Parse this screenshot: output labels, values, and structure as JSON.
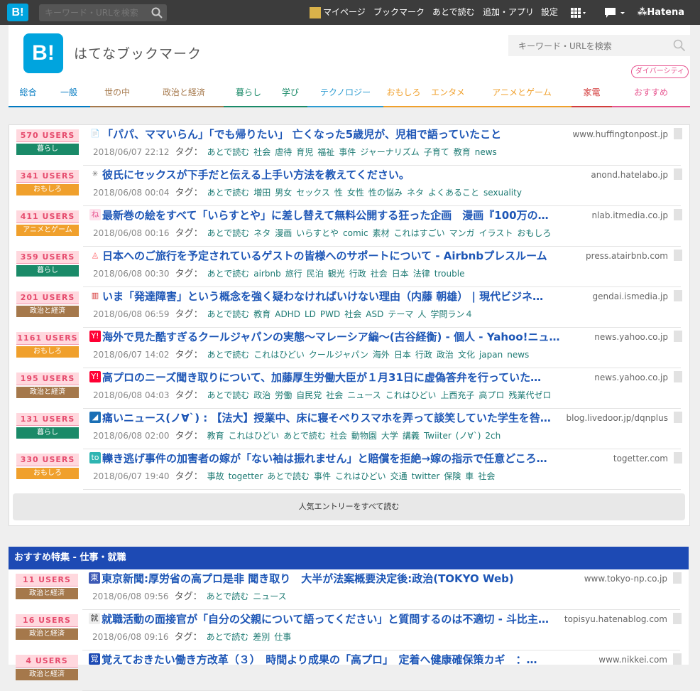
{
  "topbar": {
    "logo": "B!",
    "search_placeholder": "キーワード・URLを検索",
    "mypage": "マイページ",
    "bookmark": "ブックマーク",
    "read_later": "あとで読む",
    "add_app": "追加・アプリ",
    "settings": "設定",
    "hatena": "Hatena"
  },
  "header": {
    "logo": "B!",
    "title": "はてなブックマーク",
    "search_placeholder": "キーワード・URLを検索",
    "diversity_badge": "ダイバーシティ"
  },
  "nav": [
    {
      "label": "総合",
      "color": "#0079c1"
    },
    {
      "label": "一般",
      "color": "#0079c1"
    },
    {
      "label": "世の中",
      "color": "#a5784b"
    },
    {
      "label": "政治と経済",
      "color": "#a5784b"
    },
    {
      "label": "暮らし",
      "color": "#1a8a68"
    },
    {
      "label": "学び",
      "color": "#1a8a68"
    },
    {
      "label": "テクノロジー",
      "color": "#2b9bd1"
    },
    {
      "label": "おもしろ",
      "color": "#f0a02c"
    },
    {
      "label": "エンタメ",
      "color": "#f0a02c"
    },
    {
      "label": "アニメとゲーム",
      "color": "#f0a02c"
    },
    {
      "label": "家電",
      "color": "#d33c3c"
    },
    {
      "label": "おすすめ",
      "color": "#e7548f"
    }
  ],
  "entries": [
    {
      "users": "570 USERS",
      "category": "暮らし",
      "cat_color": "#1a8a68",
      "favicon": "📄",
      "title": "「パパ、ママいらん」「でも帰りたい」 亡くなった5歳児が、児相で語っていたこと",
      "domain": "www.huffingtonpost.jp",
      "date": "2018/06/07 22:12",
      "tag_label": "タグ：",
      "tags": [
        "あとで読む",
        "社会",
        "虐待",
        "育児",
        "福祉",
        "事件",
        "ジャーナリズム",
        "子育て",
        "教育",
        "news"
      ]
    },
    {
      "users": "341 USERS",
      "category": "おもしろ",
      "cat_color": "#f0a02c",
      "favicon": "✳",
      "title": "彼氏にセックスが下手だと伝える上手い方法を教えてください。",
      "domain": "anond.hatelabo.jp",
      "date": "2018/06/08 00:04",
      "tag_label": "タグ：",
      "tags": [
        "あとで読む",
        "増田",
        "男女",
        "セックス",
        "性",
        "女性",
        "性の悩み",
        "ネタ",
        "よくあること",
        "sexuality"
      ]
    },
    {
      "users": "411 USERS",
      "category": "アニメとゲーム",
      "cat_color": "#f0a02c",
      "favicon": "ね",
      "title": "最新巻の絵をすべて「いらすとや」に差し替えて無料公開する狂った企画　漫画『100万の…",
      "domain": "nlab.itmedia.co.jp",
      "date": "2018/06/08 00:16",
      "tag_label": "タグ：",
      "tags": [
        "あとで読む",
        "ネタ",
        "漫画",
        "いらすとや",
        "comic",
        "素材",
        "これはすごい",
        "マンガ",
        "イラスト",
        "おもしろ"
      ]
    },
    {
      "users": "359 USERS",
      "category": "暮らし",
      "cat_color": "#1a8a68",
      "favicon": "◬",
      "title": "日本へのご旅行を予定されているゲストの皆様へのサポートについて - Airbnbプレスルーム",
      "domain": "press.atairbnb.com",
      "date": "2018/06/08 00:30",
      "tag_label": "タグ：",
      "tags": [
        "あとで読む",
        "airbnb",
        "旅行",
        "民泊",
        "観光",
        "行政",
        "社会",
        "日本",
        "法律",
        "trouble"
      ]
    },
    {
      "users": "201 USERS",
      "category": "政治と経済",
      "cat_color": "#a5784b",
      "favicon": "▥",
      "title": "いま「発達障害」という概念を強く疑わなければいけない理由（内藤 朝雄） | 現代ビジネ…",
      "domain": "gendai.ismedia.jp",
      "date": "2018/06/08 06:59",
      "tag_label": "タグ：",
      "tags": [
        "あとで読む",
        "教育",
        "ADHD",
        "LD",
        "PWD",
        "社会",
        "ASD",
        "テーマ",
        "人",
        "学問ラン４"
      ]
    },
    {
      "users": "1161 USERS",
      "category": "おもしろ",
      "cat_color": "#f0a02c",
      "favicon": "Y!",
      "title": "海外で見た酷すぎるクールジャパンの実態～マレーシア編～(古谷経衡) - 個人 - Yahoo!ニュ…",
      "domain": "news.yahoo.co.jp",
      "date": "2018/06/07 14:02",
      "tag_label": "タグ：",
      "tags": [
        "あとで読む",
        "これはひどい",
        "クールジャパン",
        "海外",
        "日本",
        "行政",
        "政治",
        "文化",
        "japan",
        "news"
      ]
    },
    {
      "users": "195 USERS",
      "category": "政治と経済",
      "cat_color": "#a5784b",
      "favicon": "Y!",
      "title": "高プロのニーズ聞き取りについて、加藤厚生労働大臣が１月31日に虚偽答弁を行っていた…",
      "domain": "news.yahoo.co.jp",
      "date": "2018/06/08 04:03",
      "tag_label": "タグ：",
      "tags": [
        "あとで読む",
        "政治",
        "労働",
        "自民党",
        "社会",
        "ニュース",
        "これはひどい",
        "上西充子",
        "高プロ",
        "残業代ゼロ"
      ]
    },
    {
      "users": "131 USERS",
      "category": "暮らし",
      "cat_color": "#1a8a68",
      "favicon": "◢",
      "title": "痛いニュース(ノ∀`) : 【法大】授業中、床に寝そべりスマホを弄って談笑していた学生を咎…",
      "domain": "blog.livedoor.jp/dqnplus",
      "date": "2018/06/08 02:00",
      "tag_label": "タグ：",
      "tags": [
        "教育",
        "これはひどい",
        "あとで読む",
        "社会",
        "動物園",
        "大学",
        "講義",
        "Twiiter",
        "(ノ∀`)",
        "2ch"
      ]
    },
    {
      "users": "330 USERS",
      "category": "おもしろ",
      "cat_color": "#f0a02c",
      "favicon": "to",
      "title": "轢き逃げ事件の加害者の嫁が「ない袖は振れません」と賠償を拒絶→嫁の指示で任意どころ…",
      "domain": "togetter.com",
      "date": "2018/06/07 19:40",
      "tag_label": "タグ：",
      "tags": [
        "事故",
        "togetter",
        "あとで読む",
        "事件",
        "これはひどい",
        "交通",
        "twitter",
        "保険",
        "車",
        "社会"
      ]
    }
  ],
  "read_all": "人気エントリーをすべて読む",
  "feature": {
    "heading": "おすすめ特集 - 仕事・就職",
    "entries": [
      {
        "users": "11 USERS",
        "category": "政治と経済",
        "cat_color": "#a5784b",
        "favicon": "東",
        "title": "東京新聞:厚労省の高プロ是非 聞き取り　大半が法案概要決定後:政治(TOKYO Web)",
        "domain": "www.tokyo-np.co.jp",
        "date": "2018/06/08 09:56",
        "tag_label": "タグ：",
        "tags": [
          "あとで読む",
          "ニュース"
        ]
      },
      {
        "users": "16 USERS",
        "category": "政治と経済",
        "cat_color": "#a5784b",
        "favicon": "就",
        "title": "就職活動の面接官が「自分の父親について語ってください」と質問するのは不適切 - 斗比主…",
        "domain": "topisyu.hatenablog.com",
        "date": "2018/06/08 09:16",
        "tag_label": "タグ：",
        "tags": [
          "あとで読む",
          "差別",
          "仕事"
        ]
      },
      {
        "users": "4 USERS",
        "category": "政治と経済",
        "cat_color": "#a5784b",
        "favicon": "覚",
        "title": "覚えておきたい働き方改革（３）　時間より成果の「高プロ」　定着へ健康確保策カギ　：…",
        "domain": "www.nikkei.com",
        "date": "",
        "tag_label": "",
        "tags": []
      }
    ]
  }
}
